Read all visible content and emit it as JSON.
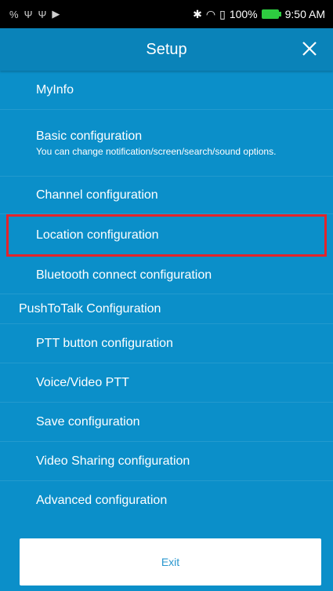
{
  "status": {
    "left_icons": [
      "notification-icon",
      "usb-icon",
      "usb-icon",
      "play-store-icon"
    ],
    "battery_pct": "100%",
    "time": "9:50 AM"
  },
  "appbar": {
    "title": "Setup",
    "close_icon": "close-icon"
  },
  "menu": {
    "myinfo": "MyInfo",
    "basic": "Basic configuration",
    "basic_sub": "You can change notification/screen/search/sound options.",
    "channel": "Channel configuration",
    "location": "Location configuration",
    "bluetooth": "Bluetooth connect configuration",
    "ptt_header": "PushToTalk Configuration",
    "ptt_button": "PTT button configuration",
    "voice_video": "Voice/Video PTT",
    "save": "Save configuration",
    "video_sharing": "Video Sharing configuration",
    "advanced": "Advanced configuration"
  },
  "exit_label": "Exit",
  "colors": {
    "background": "#0b8fc9",
    "appbar": "#0a83b9",
    "highlight": "#e3242b",
    "exit_text": "#2a97cf"
  }
}
